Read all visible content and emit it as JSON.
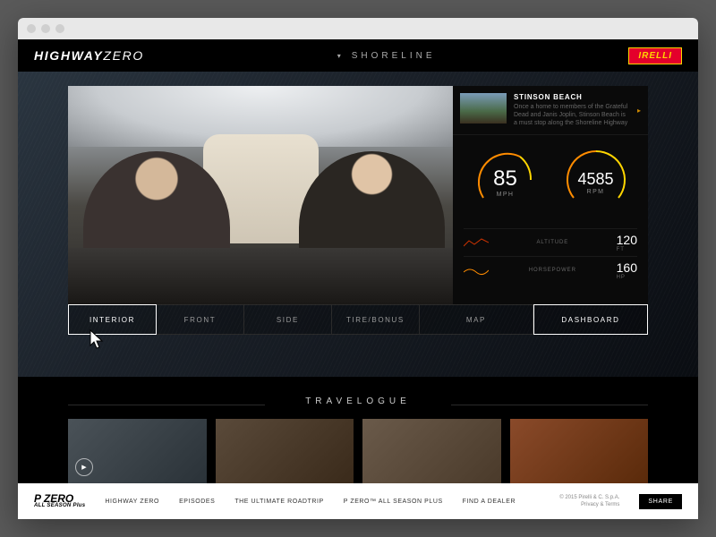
{
  "header": {
    "logo_a": "HIGHWAY",
    "logo_b": "ZERO",
    "route": "SHORELINE",
    "sponsor": "IRELLI"
  },
  "poi": {
    "title": "STINSON BEACH",
    "desc": "Once a home to members of the Grateful Dead and Janis Joplin, Stinson Beach is a must stop along the Shoreline Highway"
  },
  "gauges": {
    "speed": {
      "value": "85",
      "unit": "MPH"
    },
    "rpm": {
      "value": "4585",
      "unit": "RPM"
    },
    "altitude": {
      "label": "ALTITUDE",
      "value": "120",
      "unit": "FT"
    },
    "hp": {
      "label": "HORSEPOWER",
      "value": "160",
      "unit": "HP"
    }
  },
  "tabs": [
    "INTERIOR",
    "FRONT",
    "SIDE",
    "TIRE/BONUS",
    "MAP",
    "DASHBOARD"
  ],
  "travelogue_title": "TRAVELOGUE",
  "footer": {
    "logo_a": "P ZERO",
    "logo_b": "ALL SEASON Plus",
    "nav": [
      "HIGHWAY ZERO",
      "EPISODES",
      "THE ULTIMATE ROADTRIP",
      "P ZERO™ ALL SEASON PLUS",
      "FIND A DEALER"
    ],
    "legal_a": "© 2015 Pirelli & C. S.p.A.",
    "legal_b": "Privacy & Terms",
    "share": "SHARE"
  }
}
